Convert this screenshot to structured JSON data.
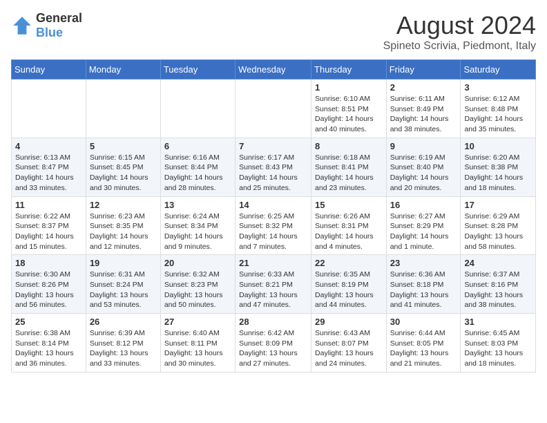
{
  "logo": {
    "general": "General",
    "blue": "Blue"
  },
  "header": {
    "title": "August 2024",
    "subtitle": "Spineto Scrivia, Piedmont, Italy"
  },
  "weekdays": [
    "Sunday",
    "Monday",
    "Tuesday",
    "Wednesday",
    "Thursday",
    "Friday",
    "Saturday"
  ],
  "weeks": [
    [
      {
        "day": "",
        "info": ""
      },
      {
        "day": "",
        "info": ""
      },
      {
        "day": "",
        "info": ""
      },
      {
        "day": "",
        "info": ""
      },
      {
        "day": "1",
        "info": "Sunrise: 6:10 AM\nSunset: 8:51 PM\nDaylight: 14 hours and 40 minutes."
      },
      {
        "day": "2",
        "info": "Sunrise: 6:11 AM\nSunset: 8:49 PM\nDaylight: 14 hours and 38 minutes."
      },
      {
        "day": "3",
        "info": "Sunrise: 6:12 AM\nSunset: 8:48 PM\nDaylight: 14 hours and 35 minutes."
      }
    ],
    [
      {
        "day": "4",
        "info": "Sunrise: 6:13 AM\nSunset: 8:47 PM\nDaylight: 14 hours and 33 minutes."
      },
      {
        "day": "5",
        "info": "Sunrise: 6:15 AM\nSunset: 8:45 PM\nDaylight: 14 hours and 30 minutes."
      },
      {
        "day": "6",
        "info": "Sunrise: 6:16 AM\nSunset: 8:44 PM\nDaylight: 14 hours and 28 minutes."
      },
      {
        "day": "7",
        "info": "Sunrise: 6:17 AM\nSunset: 8:43 PM\nDaylight: 14 hours and 25 minutes."
      },
      {
        "day": "8",
        "info": "Sunrise: 6:18 AM\nSunset: 8:41 PM\nDaylight: 14 hours and 23 minutes."
      },
      {
        "day": "9",
        "info": "Sunrise: 6:19 AM\nSunset: 8:40 PM\nDaylight: 14 hours and 20 minutes."
      },
      {
        "day": "10",
        "info": "Sunrise: 6:20 AM\nSunset: 8:38 PM\nDaylight: 14 hours and 18 minutes."
      }
    ],
    [
      {
        "day": "11",
        "info": "Sunrise: 6:22 AM\nSunset: 8:37 PM\nDaylight: 14 hours and 15 minutes."
      },
      {
        "day": "12",
        "info": "Sunrise: 6:23 AM\nSunset: 8:35 PM\nDaylight: 14 hours and 12 minutes."
      },
      {
        "day": "13",
        "info": "Sunrise: 6:24 AM\nSunset: 8:34 PM\nDaylight: 14 hours and 9 minutes."
      },
      {
        "day": "14",
        "info": "Sunrise: 6:25 AM\nSunset: 8:32 PM\nDaylight: 14 hours and 7 minutes."
      },
      {
        "day": "15",
        "info": "Sunrise: 6:26 AM\nSunset: 8:31 PM\nDaylight: 14 hours and 4 minutes."
      },
      {
        "day": "16",
        "info": "Sunrise: 6:27 AM\nSunset: 8:29 PM\nDaylight: 14 hours and 1 minute."
      },
      {
        "day": "17",
        "info": "Sunrise: 6:29 AM\nSunset: 8:28 PM\nDaylight: 13 hours and 58 minutes."
      }
    ],
    [
      {
        "day": "18",
        "info": "Sunrise: 6:30 AM\nSunset: 8:26 PM\nDaylight: 13 hours and 56 minutes."
      },
      {
        "day": "19",
        "info": "Sunrise: 6:31 AM\nSunset: 8:24 PM\nDaylight: 13 hours and 53 minutes."
      },
      {
        "day": "20",
        "info": "Sunrise: 6:32 AM\nSunset: 8:23 PM\nDaylight: 13 hours and 50 minutes."
      },
      {
        "day": "21",
        "info": "Sunrise: 6:33 AM\nSunset: 8:21 PM\nDaylight: 13 hours and 47 minutes."
      },
      {
        "day": "22",
        "info": "Sunrise: 6:35 AM\nSunset: 8:19 PM\nDaylight: 13 hours and 44 minutes."
      },
      {
        "day": "23",
        "info": "Sunrise: 6:36 AM\nSunset: 8:18 PM\nDaylight: 13 hours and 41 minutes."
      },
      {
        "day": "24",
        "info": "Sunrise: 6:37 AM\nSunset: 8:16 PM\nDaylight: 13 hours and 38 minutes."
      }
    ],
    [
      {
        "day": "25",
        "info": "Sunrise: 6:38 AM\nSunset: 8:14 PM\nDaylight: 13 hours and 36 minutes."
      },
      {
        "day": "26",
        "info": "Sunrise: 6:39 AM\nSunset: 8:12 PM\nDaylight: 13 hours and 33 minutes."
      },
      {
        "day": "27",
        "info": "Sunrise: 6:40 AM\nSunset: 8:11 PM\nDaylight: 13 hours and 30 minutes."
      },
      {
        "day": "28",
        "info": "Sunrise: 6:42 AM\nSunset: 8:09 PM\nDaylight: 13 hours and 27 minutes."
      },
      {
        "day": "29",
        "info": "Sunrise: 6:43 AM\nSunset: 8:07 PM\nDaylight: 13 hours and 24 minutes."
      },
      {
        "day": "30",
        "info": "Sunrise: 6:44 AM\nSunset: 8:05 PM\nDaylight: 13 hours and 21 minutes."
      },
      {
        "day": "31",
        "info": "Sunrise: 6:45 AM\nSunset: 8:03 PM\nDaylight: 13 hours and 18 minutes."
      }
    ]
  ]
}
